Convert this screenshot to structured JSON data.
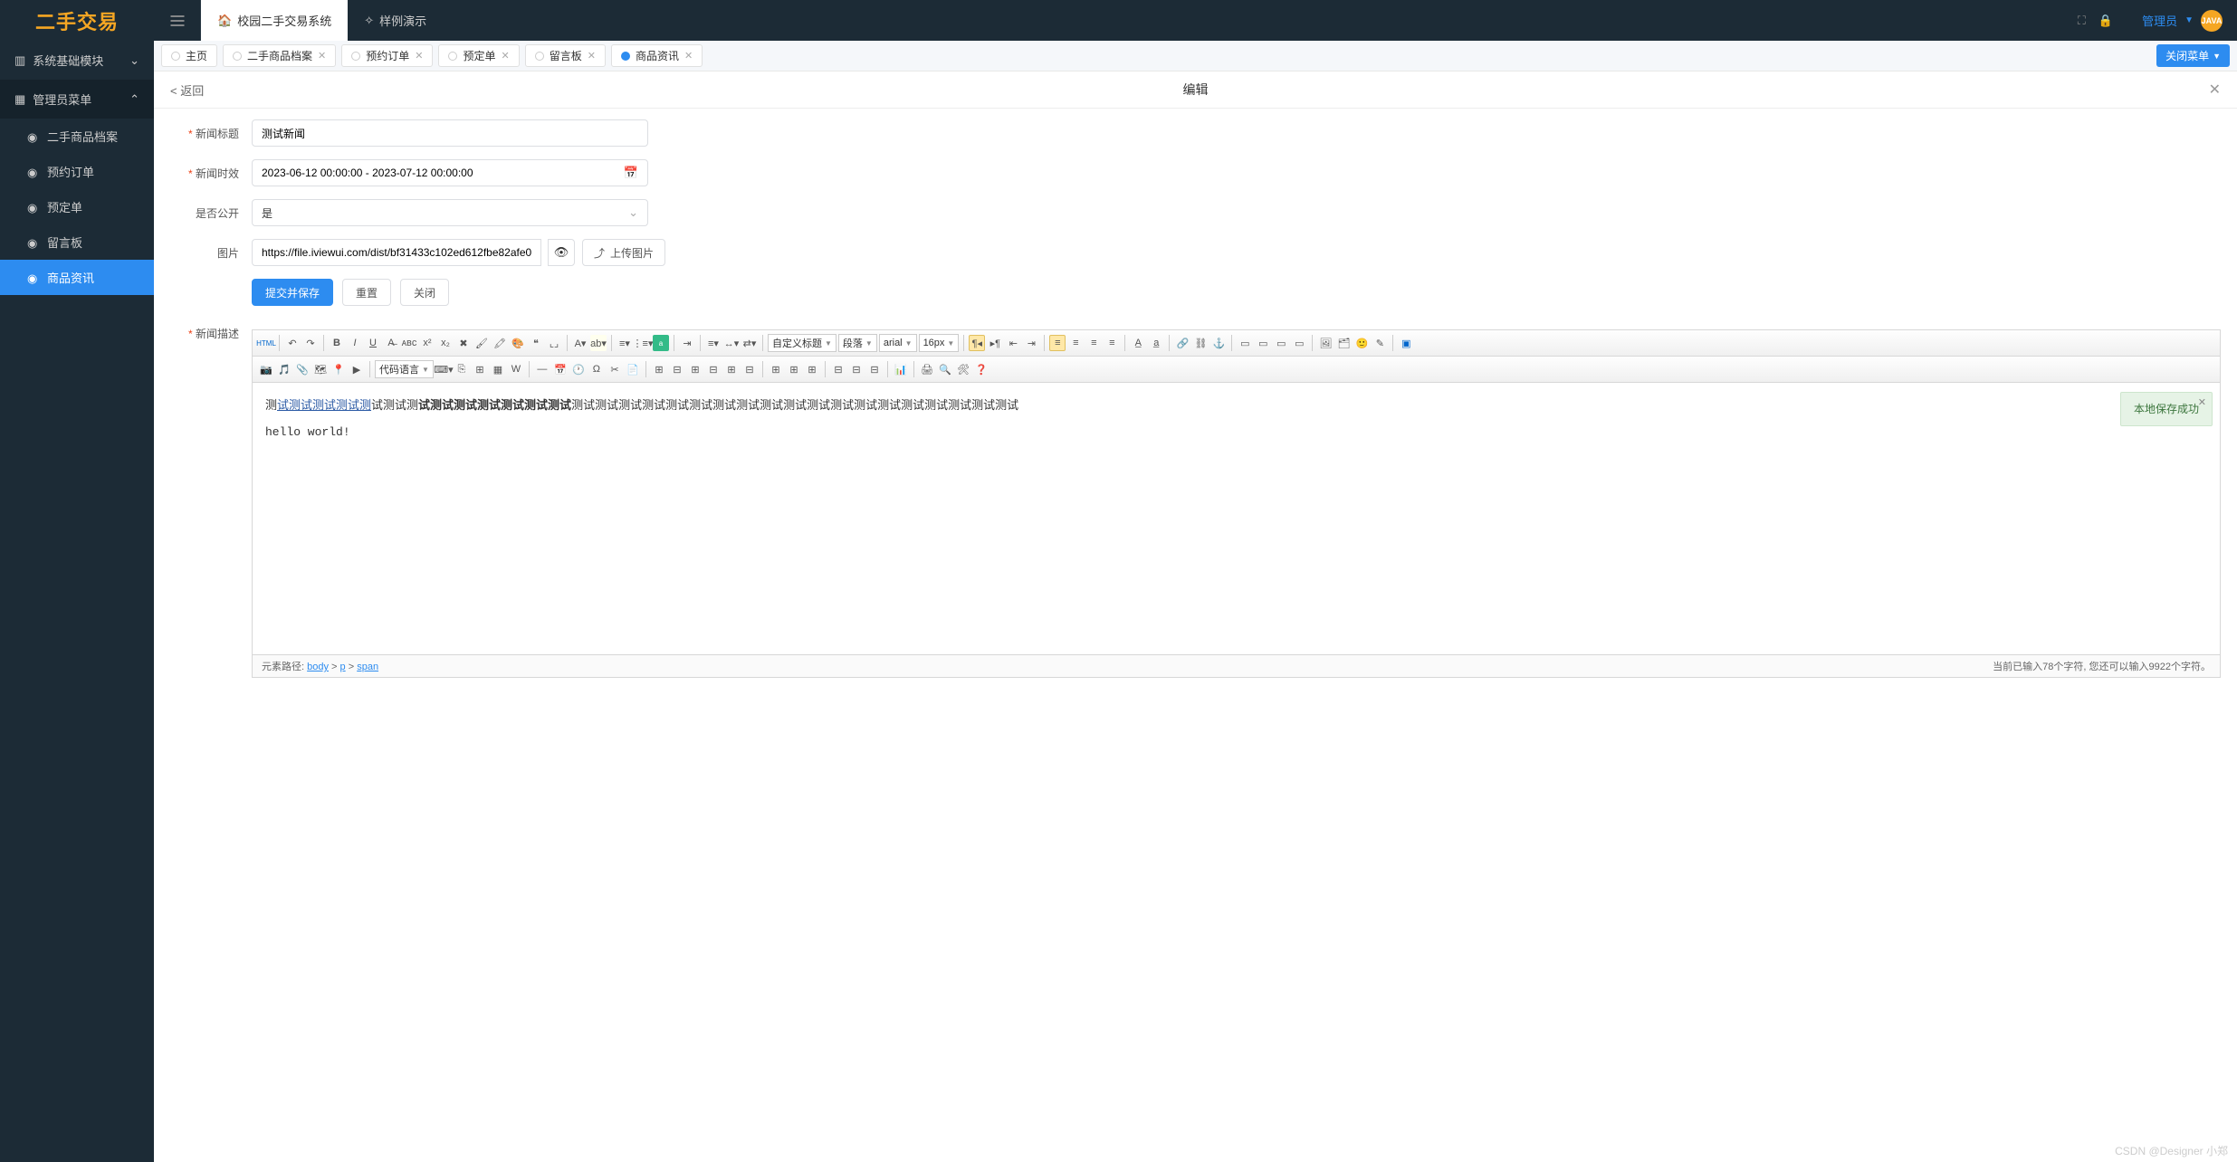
{
  "logo": "二手交易",
  "topnav": {
    "item1": "校园二手交易系统",
    "item2": "样例演示"
  },
  "user": {
    "name": "管理员",
    "avatar_text": "JAVA"
  },
  "sidebar": {
    "group1": "系统基础模块",
    "group2": "管理员菜单",
    "items": [
      "二手商品档案",
      "预约订单",
      "预定单",
      "留言板",
      "商品资讯"
    ]
  },
  "tabs": [
    {
      "label": "主页",
      "closable": false
    },
    {
      "label": "二手商品档案",
      "closable": true
    },
    {
      "label": "预约订单",
      "closable": true
    },
    {
      "label": "预定单",
      "closable": true
    },
    {
      "label": "留言板",
      "closable": true
    },
    {
      "label": "商品资讯",
      "closable": true,
      "active": true
    }
  ],
  "close_menu": "关闭菜单",
  "panel": {
    "back": "< 返回",
    "title": "编辑"
  },
  "form": {
    "title_label": "新闻标题",
    "title_value": "测试新闻",
    "time_label": "新闻时效",
    "time_value": "2023-06-12 00:00:00 - 2023-07-12 00:00:00",
    "public_label": "是否公开",
    "public_value": "是",
    "image_label": "图片",
    "image_value": "https://file.iviewui.com/dist/bf31433c102ed612fbe82afe000dda40",
    "upload_label": "上传图片",
    "submit": "提交并保存",
    "reset": "重置",
    "close": "关闭",
    "desc_label": "新闻描述"
  },
  "editor": {
    "selects": {
      "codelang": "代码语言",
      "custom_title": "自定义标题",
      "paragraph": "段落",
      "font": "arial",
      "size": "16px"
    },
    "content_prefix": "测",
    "content_u": "试测试测试测试测",
    "content_mid": "试测试测",
    "content_b": "试测试测试测试测试测试测试",
    "content_rest": "测试测试测试测试测试测试测试测试测试测试测试测试测试测试测试测试测试测试测试",
    "content_line2": "hello  world!",
    "notice": "本地保存成功",
    "path_label": "元素路径:",
    "path_body": "body",
    "path_p": "p",
    "path_span": "span",
    "count": "当前已输入78个字符, 您还可以输入9922个字符。"
  },
  "watermark": "CSDN @Designer 小郑"
}
